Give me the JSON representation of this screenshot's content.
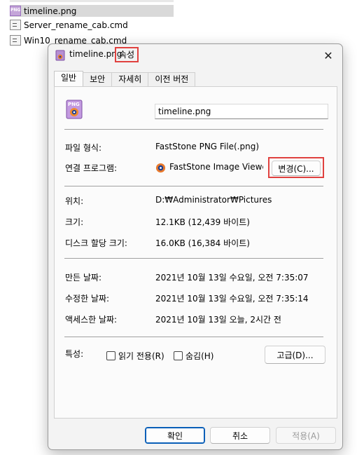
{
  "background_files": [
    {
      "name": "timeline.png",
      "icon": "png-file-icon",
      "selected": true
    },
    {
      "name": "Server_rename_cab.cmd",
      "icon": "cmd-file-icon",
      "selected": false
    },
    {
      "name": "Win10_rename_cab.cmd",
      "icon": "cmd-file-icon",
      "selected": false
    }
  ],
  "dialog": {
    "title_filename": "timeline.png",
    "title_suffix": "속성",
    "close_label": "✕",
    "tabs": [
      "일반",
      "보안",
      "자세히",
      "이전 버전"
    ],
    "active_tab": "일반",
    "file_name": "timeline.png",
    "rows": {
      "file_type_label": "파일 형식:",
      "file_type_value": "FastStone PNG File(.png)",
      "opens_with_label": "연결 프로그램:",
      "opens_with_value": "FastStone Image Viewer",
      "change_button": "변경(C)...",
      "location_label": "위치:",
      "location_value": "D:₩Administrator₩Pictures",
      "size_label": "크기:",
      "size_value": "12.1KB (12,439 바이트)",
      "disk_size_label": "디스크 할당 크기:",
      "disk_size_value": "16.0KB (16,384 바이트)",
      "created_label": "만든 날짜:",
      "created_value": "2021년 10월 13일 수요일, 오전 7:35:07",
      "modified_label": "수정한 날짜:",
      "modified_value": "2021년 10월 13일 수요일, 오전 7:35:14",
      "accessed_label": "액세스한 날짜:",
      "accessed_value": "2021년 10월 13일 오늘, 2시간 전",
      "attributes_label": "특성:",
      "readonly_label": "읽기 전용(R)",
      "hidden_label": "숨김(H)",
      "advanced_button": "고급(D)..."
    },
    "buttons": {
      "ok": "확인",
      "cancel": "취소",
      "apply": "적용(A)"
    },
    "highlight_color": "#e0413f",
    "accent_color": "#0a5fb8"
  }
}
